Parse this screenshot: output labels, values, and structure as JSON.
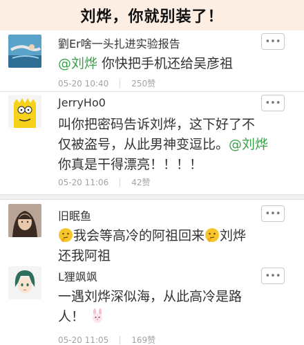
{
  "banner": {
    "title": "刘烨，你就别装了！"
  },
  "comments": [
    {
      "username": "劉Er啥一头扎进实验报告",
      "mention": "@刘烨",
      "text": " 你快把手机还给吴彦祖",
      "time": "05-20 10:40",
      "likes": "250赞"
    },
    {
      "username": "JerryHo0",
      "text_lines": [
        "叫你把密码告诉刘烨，这下好了不",
        "仅被盗号，从此男神变逗比。",
        "你真是干得漂亮！！！！"
      ],
      "mention": "@刘烨",
      "time": "05-20 11:06",
      "likes": "42赞"
    },
    {
      "username": "旧眠鱼",
      "text_part1": "我会等高冷的阿祖回来",
      "text_part2": "刘烨",
      "text_line2": "还我阿祖",
      "emoji": "thinking-face-emoji"
    },
    {
      "username": "L狸飒飒",
      "text_line1": "一遇刘烨深似海，从此高冷是路",
      "text_line2": "人！",
      "emoji": "rabbit-face-emoji",
      "time": "05-20 11:05",
      "likes": "169赞"
    }
  ],
  "more_button_label": "•••"
}
